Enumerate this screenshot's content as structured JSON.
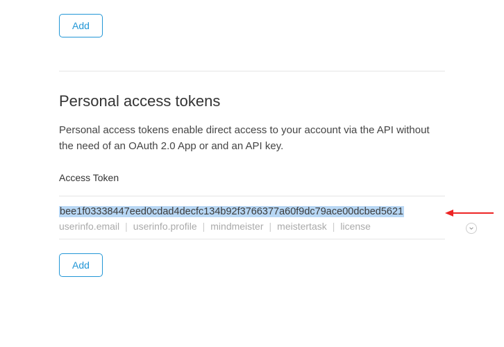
{
  "top": {
    "add_label": "Add"
  },
  "section": {
    "title": "Personal access tokens",
    "description": "Personal access tokens enable direct access to your account via the API without the need of an OAuth 2.0 App or and an API key.",
    "access_token_label": "Access Token",
    "token_value": "bee1f03338447eed0cdad4decfc134b92f3766377a60f9dc79ace00dcbed5621",
    "scopes": [
      "userinfo.email",
      "userinfo.profile",
      "mindmeister",
      "meistertask",
      "license"
    ],
    "add_label": "Add"
  },
  "colors": {
    "accent": "#2196d6",
    "highlight": "#b8d7f4",
    "arrow": "#ed2424"
  }
}
